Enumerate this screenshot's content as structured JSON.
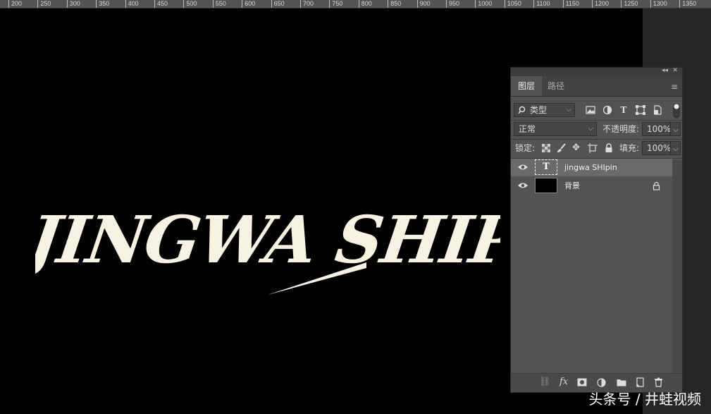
{
  "ruler": {
    "ticks": [
      "200",
      "250",
      "300",
      "350",
      "400",
      "450",
      "500",
      "550",
      "600",
      "650",
      "700",
      "750",
      "800",
      "850",
      "900",
      "950",
      "1000",
      "1050",
      "1100",
      "1150",
      "1200",
      "1250",
      "1300",
      "1350"
    ]
  },
  "canvas": {
    "artwork_text": "JINGWA SHIPIN",
    "text_color": "#f7f3e3",
    "background_color": "#000000"
  },
  "panel": {
    "collapse_icon": "double-chevron-left",
    "close_icon": "close",
    "tabs": [
      {
        "label": "图层",
        "active": true
      },
      {
        "label": "路径",
        "active": false
      }
    ],
    "filter": {
      "search_icon": "search",
      "kind_label": "类型",
      "filter_icons": [
        "image-filter",
        "adjustment-filter",
        "text-filter",
        "shape-filter",
        "smart-object-filter"
      ]
    },
    "blend": {
      "mode": "正常",
      "opacity_label": "不透明度:",
      "opacity_value": "100%"
    },
    "lock": {
      "label": "锁定:",
      "icons": [
        "lock-transparent-pixels",
        "lock-image-pixels",
        "lock-position",
        "lock-artboard",
        "lock-all"
      ],
      "fill_label": "填充:",
      "fill_value": "100%"
    },
    "layers": [
      {
        "name": "jingwa SHIpin",
        "type": "text",
        "thumb_glyph": "T",
        "visible": true,
        "selected": true
      },
      {
        "name": "背景",
        "type": "background",
        "visible": true,
        "selected": false,
        "locked": true
      }
    ],
    "bottom_icons": [
      "link-layers",
      "fx",
      "layer-mask",
      "adjustment-layer",
      "group",
      "new-layer",
      "delete"
    ],
    "fx_label": "fx"
  },
  "watermark": "头条号 / 井蛙视频"
}
